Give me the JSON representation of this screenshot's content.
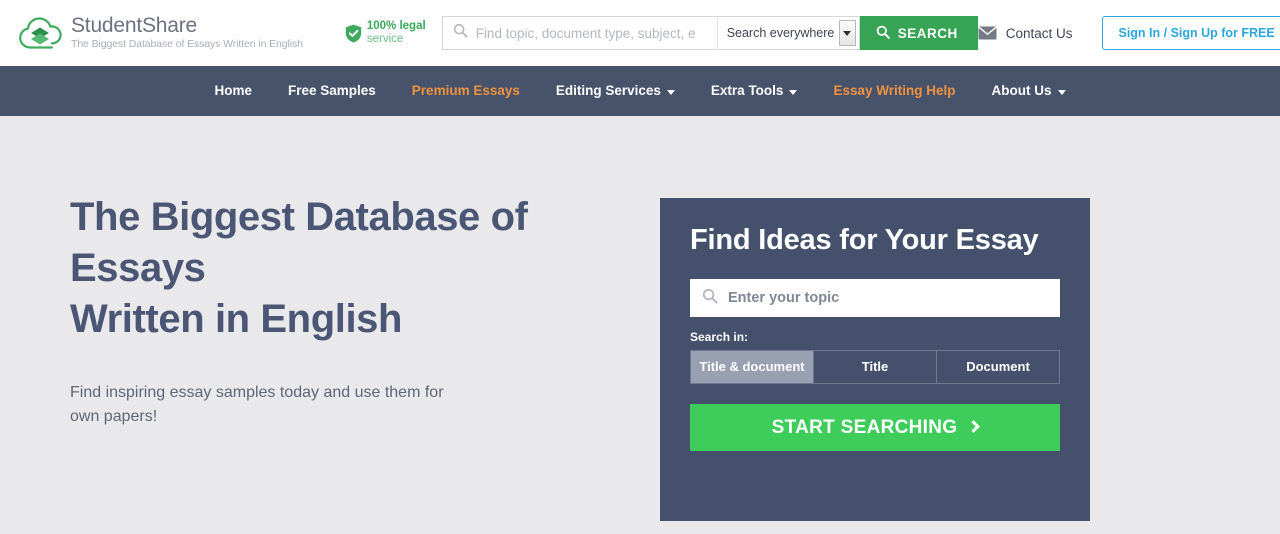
{
  "header": {
    "logo": {
      "icon": "cloud-book-logo-icon",
      "name": "StudentShare",
      "tagline": "The Biggest Database of Essays Written in English"
    },
    "legal_badge": {
      "icon": "shield-check-icon",
      "line1": "100% legal",
      "line2": "service"
    },
    "search": {
      "icon": "search-icon",
      "placeholder": "Find topic, document type, subject, e",
      "value": "",
      "scope_selected": "Search everywhere",
      "scope_options": [
        "Search everywhere"
      ],
      "submit_label": "SEARCH",
      "submit_icon": "search-icon",
      "submit_color": "#37a455"
    },
    "contact": {
      "icon": "envelope-icon",
      "label": "Contact Us"
    },
    "signin": {
      "label": "Sign In / Sign Up for FREE",
      "color": "#2ba6e0"
    }
  },
  "nav": {
    "background": "#47526b",
    "accent_color": "#f0933f",
    "items": [
      {
        "label": "Home",
        "accent": false,
        "caret": false
      },
      {
        "label": "Free Samples",
        "accent": false,
        "caret": false
      },
      {
        "label": "Premium Essays",
        "accent": true,
        "caret": false
      },
      {
        "label": "Editing Services",
        "accent": false,
        "caret": true
      },
      {
        "label": "Extra Tools",
        "accent": false,
        "caret": true
      },
      {
        "label": "Essay Writing Help",
        "accent": true,
        "caret": false
      },
      {
        "label": "About Us",
        "accent": false,
        "caret": true
      }
    ]
  },
  "hero": {
    "title_line1": "The Biggest Database of Essays",
    "title_line2": "Written in English",
    "subtitle": "Find inspiring essay samples today and use them for own papers!",
    "panel": {
      "background": "#45516c",
      "title": "Find Ideas for Your Essay",
      "search_icon": "search-icon",
      "search_placeholder": "Enter your topic",
      "search_value": "",
      "search_in_label": "Search in:",
      "tabs": [
        {
          "label": "Title & document",
          "active": true
        },
        {
          "label": "Title",
          "active": false
        },
        {
          "label": "Document",
          "active": false
        }
      ],
      "cta_label": "START SEARCHING",
      "cta_icon": "chevron-right-icon",
      "cta_color": "#3ecc5a"
    }
  }
}
